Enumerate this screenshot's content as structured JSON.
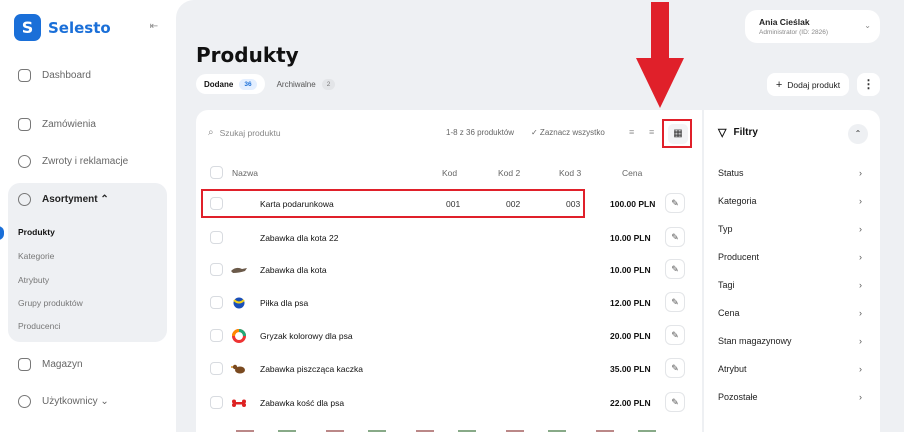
{
  "app": {
    "name": "Selesto"
  },
  "sidebar": {
    "items": [
      {
        "label": "Dashboard"
      },
      {
        "label": "Zamówienia"
      },
      {
        "label": "Zwroty i reklamacje"
      },
      {
        "label": "Asortyment ⌃"
      },
      {
        "label": "Magazyn"
      },
      {
        "label": "Użytkownicy ⌄"
      }
    ],
    "sub_items": [
      {
        "label": "Produkty"
      },
      {
        "label": "Kategorie"
      },
      {
        "label": "Atrybuty"
      },
      {
        "label": "Grupy produktów"
      },
      {
        "label": "Producenci"
      }
    ]
  },
  "user": {
    "name": "Ania Cieślak",
    "role": "Administrator (ID: 2826)"
  },
  "page": {
    "title": "Produkty"
  },
  "tabs": [
    {
      "label": "Dodane",
      "count": "36"
    },
    {
      "label": "Archiwalne",
      "count": "2"
    }
  ],
  "actions": {
    "add_product": "Dodaj produkt",
    "more": "⋮"
  },
  "toolbar": {
    "search_placeholder": "Szukaj produktu",
    "range_info": "1-8 z 36 produktów",
    "select_all": "✓ Zaznacz wszystko"
  },
  "table": {
    "headers": {
      "name": "Nazwa",
      "kod": "Kod",
      "kod2": "Kod 2",
      "kod3": "Kod 3",
      "price": "Cena"
    },
    "rows": [
      {
        "name": "Karta podarunkowa",
        "kod": "001",
        "kod2": "002",
        "kod3": "003",
        "price": "100.00 PLN"
      },
      {
        "name": "Zabawka dla kota 22",
        "kod": "",
        "kod2": "",
        "kod3": "",
        "price": "10.00 PLN"
      },
      {
        "name": "Zabawka dla kota",
        "kod": "",
        "kod2": "",
        "kod3": "",
        "price": "10.00 PLN"
      },
      {
        "name": "Piłka dla psa",
        "kod": "",
        "kod2": "",
        "kod3": "",
        "price": "12.00 PLN"
      },
      {
        "name": "Gryzak kolorowy dla psa",
        "kod": "",
        "kod2": "",
        "kod3": "",
        "price": "20.00 PLN"
      },
      {
        "name": "Zabawka piszcząca kaczka",
        "kod": "",
        "kod2": "",
        "kod3": "",
        "price": "35.00 PLN"
      },
      {
        "name": "Zabawka kość dla psa",
        "kod": "",
        "kod2": "",
        "kod3": "",
        "price": "22.00 PLN"
      }
    ]
  },
  "filters": {
    "title": "Filtry",
    "items": [
      {
        "label": "Status"
      },
      {
        "label": "Kategoria"
      },
      {
        "label": "Typ"
      },
      {
        "label": "Producent"
      },
      {
        "label": "Tagi"
      },
      {
        "label": "Cena"
      },
      {
        "label": "Stan magazynowy"
      },
      {
        "label": "Atrybut"
      },
      {
        "label": "Pozostałe"
      }
    ]
  },
  "colors": {
    "accent": "#1a6fd8",
    "highlight": "#e0202a"
  }
}
